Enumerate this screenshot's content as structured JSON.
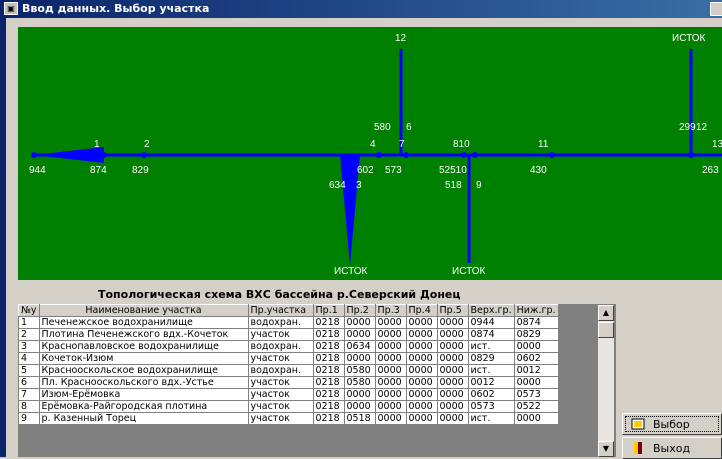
{
  "window": {
    "title": "Ввод данных. Выбор участка"
  },
  "map": {
    "background": "#008000",
    "line_color": "#0000ff",
    "text_color": "#ffffff",
    "labels": [
      {
        "t": "12"
      },
      {
        "t": "ИСТОК"
      },
      {
        "t": "580"
      },
      {
        "t": "6"
      },
      {
        "t": "299"
      },
      {
        "t": "12"
      },
      {
        "t": "13"
      },
      {
        "t": "1"
      },
      {
        "t": "2"
      },
      {
        "t": "4"
      },
      {
        "t": "7"
      },
      {
        "t": "810"
      },
      {
        "t": "11"
      },
      {
        "t": "944"
      },
      {
        "t": "874"
      },
      {
        "t": "829"
      },
      {
        "t": "602"
      },
      {
        "t": "573"
      },
      {
        "t": "52510"
      },
      {
        "t": "430"
      },
      {
        "t": "263"
      },
      {
        "t": "634"
      },
      {
        "t": "3"
      },
      {
        "t": "518"
      },
      {
        "t": "9"
      },
      {
        "t": "ИСТОК"
      },
      {
        "t": "ИСТОК"
      }
    ]
  },
  "schema_title": "Топологическая схема ВХС бассейна р.Северский Донец",
  "table": {
    "columns": [
      "№у",
      "Наименование участка",
      "Пр.участка",
      "Пр.1",
      "Пр.2",
      "Пр.3",
      "Пр.4",
      "Пр.5",
      "Верх.гр.",
      "Ниж.гр."
    ],
    "rows": [
      [
        "1",
        "Печенежское водохранилище",
        "водохран.",
        "0218",
        "0000",
        "0000",
        "0000",
        "0000",
        "0944",
        "0874"
      ],
      [
        "2",
        "Плотина Печенежского вдх.-Кочеток",
        "участок",
        "0218",
        "0000",
        "0000",
        "0000",
        "0000",
        "0874",
        "0829"
      ],
      [
        "3",
        "Краснопавловское водохранилище",
        "водохран.",
        "0218",
        "0634",
        "0000",
        "0000",
        "0000",
        "ист.",
        "0000"
      ],
      [
        "4",
        "Кочеток-Изюм",
        "участок",
        "0218",
        "0000",
        "0000",
        "0000",
        "0000",
        "0829",
        "0602"
      ],
      [
        "5",
        "Краснооскольское водохранилище",
        "водохран.",
        "0218",
        "0580",
        "0000",
        "0000",
        "0000",
        "ист.",
        "0012"
      ],
      [
        "6",
        "Пл. Краснооскольского вдх.-Устье",
        "участок",
        "0218",
        "0580",
        "0000",
        "0000",
        "0000",
        "0012",
        "0000"
      ],
      [
        "7",
        "Изюм-Ерёмовка",
        "участок",
        "0218",
        "0000",
        "0000",
        "0000",
        "0000",
        "0602",
        "0573"
      ],
      [
        "8",
        "Ерёмовка-Райгородская плотина",
        "участок",
        "0218",
        "0000",
        "0000",
        "0000",
        "0000",
        "0573",
        "0522"
      ],
      [
        "9",
        "р. Казенный Торец",
        "участок",
        "0218",
        "0518",
        "0000",
        "0000",
        "0000",
        "ист.",
        "0000"
      ]
    ]
  },
  "buttons": {
    "select": "Выбор",
    "exit": "Выход"
  }
}
